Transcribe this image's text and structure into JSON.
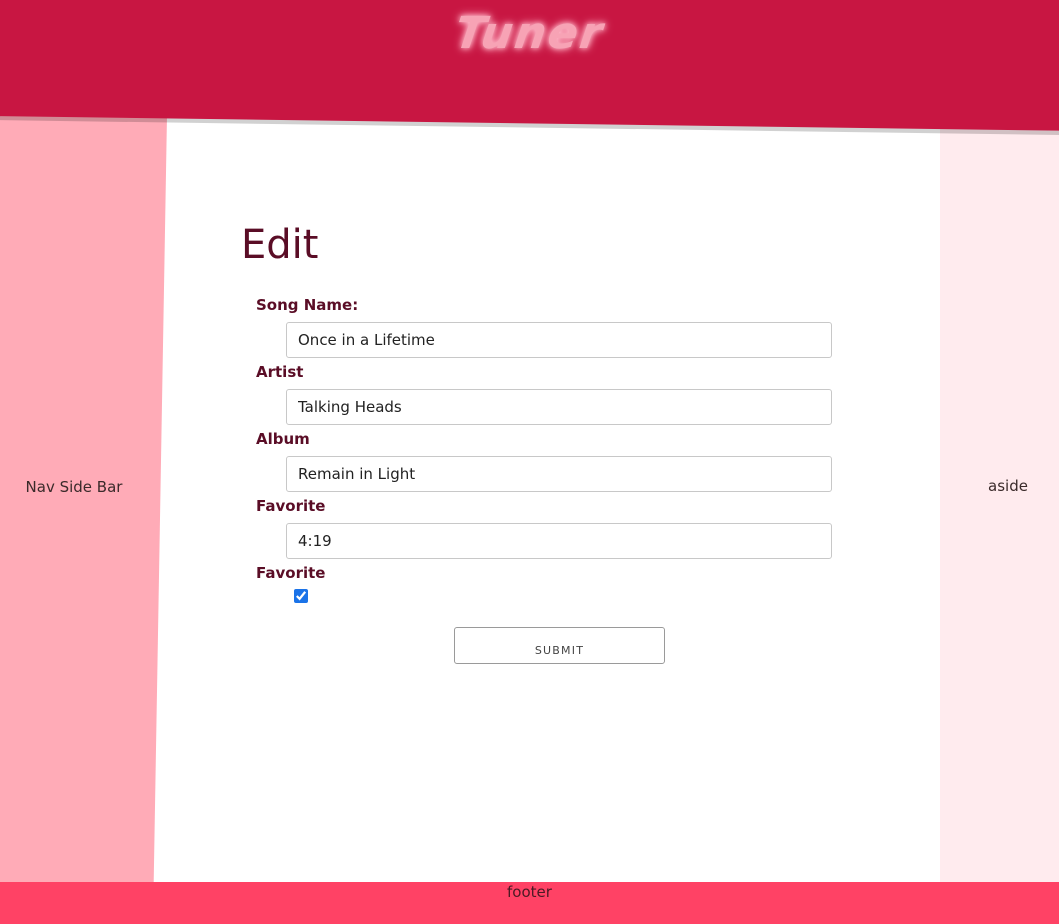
{
  "header": {
    "logo_text": "Tuner"
  },
  "nav": {
    "label": "Nav Side Bar"
  },
  "aside": {
    "label": "aside"
  },
  "footer": {
    "label": "footer"
  },
  "form": {
    "title": "Edit",
    "fields": [
      {
        "label": "Song Name:",
        "value": "Once in a Lifetime"
      },
      {
        "label": "Artist",
        "value": "Talking Heads"
      },
      {
        "label": "Album",
        "value": "Remain in Light"
      },
      {
        "label": "Favorite",
        "value": "4:19"
      }
    ],
    "favorite": {
      "label": "Favorite",
      "checked": true
    },
    "submit_label": "SUBMIT"
  },
  "colors": {
    "header": "#c81642",
    "nav": "#ffabb7",
    "aside": "#ffebee",
    "footer": "#ff4265",
    "heading_text": "#5a0d26"
  }
}
